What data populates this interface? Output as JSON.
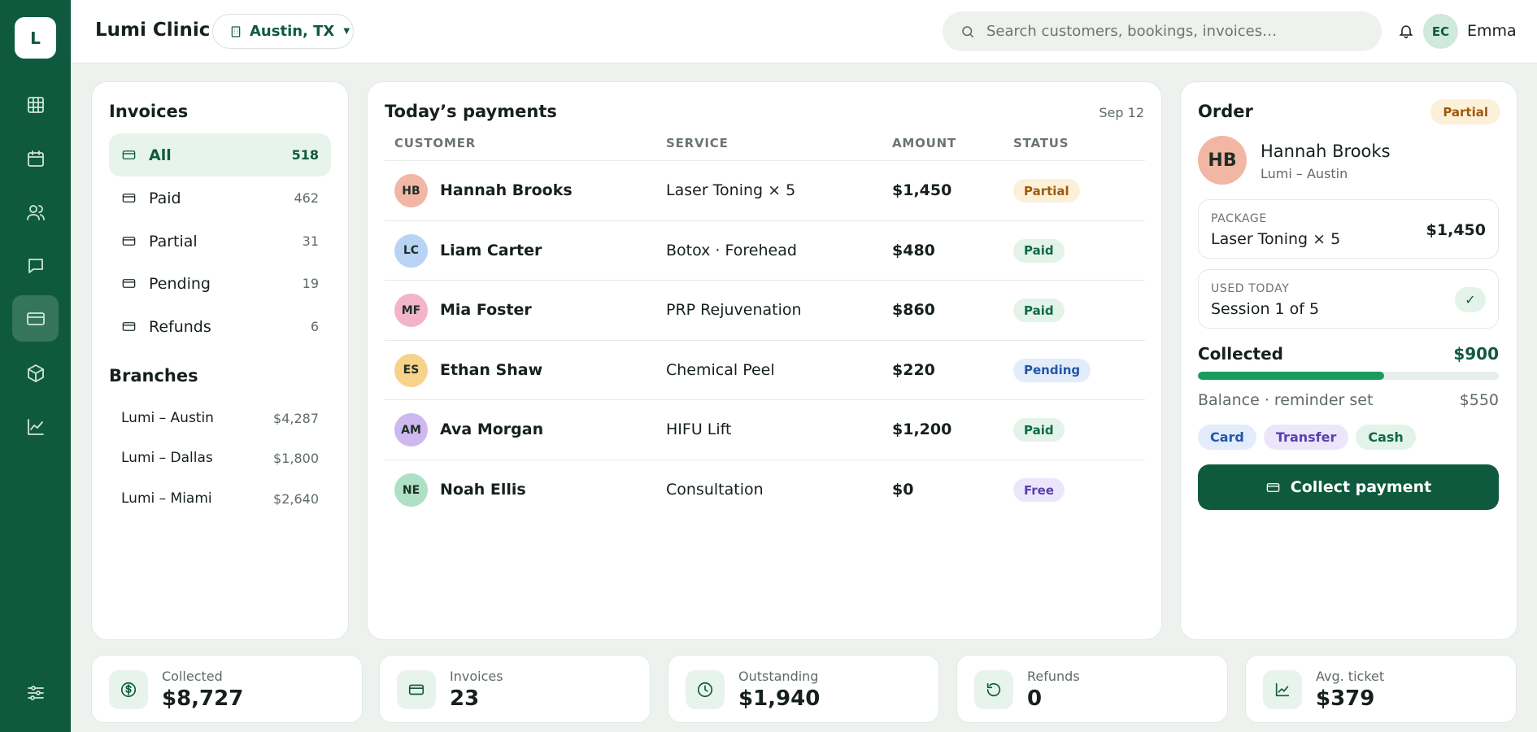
{
  "app": {
    "logo_letter": "L",
    "name": "Lumi Clinic",
    "location": "Austin, TX"
  },
  "search": {
    "placeholder": "Search customers, bookings, invoices…"
  },
  "user": {
    "initials": "EC",
    "name": "Emma"
  },
  "sidebar": {
    "icons": [
      "grid-icon",
      "calendar-icon",
      "users-icon",
      "chat-icon",
      "card-icon",
      "box-icon",
      "chart-icon"
    ],
    "active": "card-icon",
    "bottom_icon": "sliders-icon"
  },
  "invoices": {
    "title": "Invoices",
    "filters": [
      {
        "label": "All",
        "count": "518",
        "active": true
      },
      {
        "label": "Paid",
        "count": "462"
      },
      {
        "label": "Partial",
        "count": "31"
      },
      {
        "label": "Pending",
        "count": "19"
      },
      {
        "label": "Refunds",
        "count": "6"
      }
    ],
    "branches_title": "Branches",
    "branches": [
      {
        "name": "Lumi – Austin",
        "value": "$4,287"
      },
      {
        "name": "Lumi – Dallas",
        "value": "$1,800"
      },
      {
        "name": "Lumi – Miami",
        "value": "$2,640"
      }
    ]
  },
  "payments": {
    "title": "Today’s payments",
    "date": "Sep 12",
    "columns": {
      "customer": "CUSTOMER",
      "service": "SERVICE",
      "amount": "AMOUNT",
      "status": "STATUS"
    },
    "rows": [
      {
        "initials": "HB",
        "name": "Hannah Brooks",
        "service": "Laser Toning × 5",
        "amount": "$1,450",
        "status": "Partial",
        "avatar_color": "#f2b7a4"
      },
      {
        "initials": "LC",
        "name": "Liam Carter",
        "service": "Botox · Forehead",
        "amount": "$480",
        "status": "Paid",
        "avatar_color": "#b9d3f5"
      },
      {
        "initials": "MF",
        "name": "Mia Foster",
        "service": "PRP Rejuvenation",
        "amount": "$860",
        "status": "Paid",
        "avatar_color": "#f3b4ca"
      },
      {
        "initials": "ES",
        "name": "Ethan Shaw",
        "service": "Chemical Peel",
        "amount": "$220",
        "status": "Pending",
        "avatar_color": "#f7d28b"
      },
      {
        "initials": "AM",
        "name": "Ava Morgan",
        "service": "HIFU Lift",
        "amount": "$1,200",
        "status": "Paid",
        "avatar_color": "#cdb8ef"
      },
      {
        "initials": "NE",
        "name": "Noah Ellis",
        "service": "Consultation",
        "amount": "$0",
        "status": "Free",
        "avatar_color": "#aee0c5"
      }
    ],
    "status_colors": {
      "Partial": {
        "bg": "#fdf0d9",
        "fg": "#9b5c0c"
      },
      "Paid": {
        "bg": "#e3f3ea",
        "fg": "#0f6a45"
      },
      "Pending": {
        "bg": "#e3ecfb",
        "fg": "#2456a6"
      },
      "Free": {
        "bg": "#ece6fb",
        "fg": "#5b3fae"
      }
    }
  },
  "order": {
    "title": "Order",
    "status": "Partial",
    "customer_initials": "HB",
    "customer_name": "Hannah Brooks",
    "customer_branch": "Lumi – Austin",
    "package_label": "PACKAGE",
    "package_name": "Laser Toning × 5",
    "package_price": "$1,450",
    "used_label": "USED TODAY",
    "used_value": "Session 1 of 5",
    "check_icon": "✓",
    "collected_label": "Collected",
    "collected_value": "$900",
    "collected_fraction": 0.62,
    "balance_label": "Balance · reminder set",
    "balance_value": "$550",
    "methods": [
      {
        "label": "Card",
        "bg": "#e3ecfb",
        "fg": "#2456a6"
      },
      {
        "label": "Transfer",
        "bg": "#ece6fb",
        "fg": "#5b3fae"
      },
      {
        "label": "Cash",
        "bg": "#e3f3ea",
        "fg": "#0f6a45"
      }
    ],
    "collect_button": "Collect payment"
  },
  "stats": [
    {
      "label": "Collected",
      "value": "$8,727",
      "icon": "dollar-icon"
    },
    {
      "label": "Invoices",
      "value": "23",
      "icon": "invoice-card-icon"
    },
    {
      "label": "Outstanding",
      "value": "$1,940",
      "icon": "clock-icon"
    },
    {
      "label": "Refunds",
      "value": "0",
      "icon": "refresh-icon"
    },
    {
      "label": "Avg. ticket",
      "value": "$379",
      "icon": "trend-icon"
    }
  ]
}
